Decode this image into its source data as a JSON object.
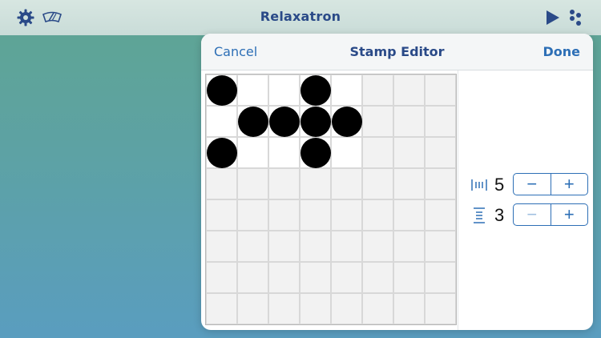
{
  "app": {
    "title": "Relaxatron",
    "icons": {
      "settings": "gear-icon",
      "clear": "wiper-icon",
      "play": "play-icon",
      "stamp": "dots-icon"
    },
    "colors": {
      "accent": "#2d6fb6",
      "title": "#2a4a88"
    }
  },
  "popover": {
    "title": "Stamp Editor",
    "cancel_label": "Cancel",
    "done_label": "Done"
  },
  "grid": {
    "cols": 8,
    "rows": 8,
    "active_cols": 5,
    "active_rows": 3,
    "filled": [
      [
        0,
        0
      ],
      [
        3,
        0
      ],
      [
        1,
        1
      ],
      [
        2,
        1
      ],
      [
        3,
        1
      ],
      [
        4,
        1
      ],
      [
        0,
        2
      ],
      [
        3,
        2
      ]
    ]
  },
  "controls": {
    "width": {
      "icon": "width-icon",
      "value": "5",
      "minus": "−",
      "plus": "+",
      "minus_enabled": true
    },
    "height": {
      "icon": "height-icon",
      "value": "3",
      "minus": "−",
      "plus": "+",
      "minus_enabled": false
    }
  }
}
